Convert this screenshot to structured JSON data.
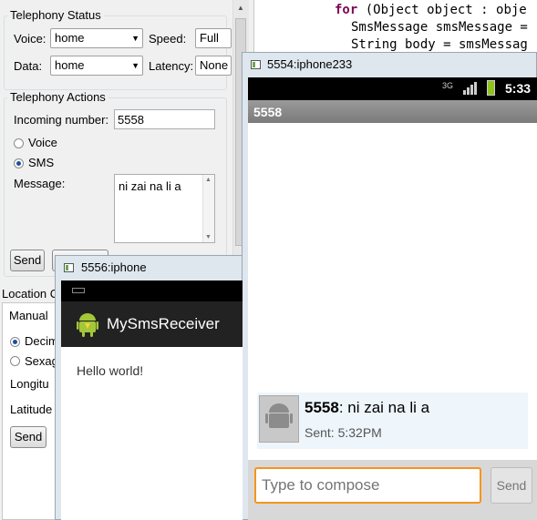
{
  "telephony_status": {
    "title": "Telephony Status",
    "voice_label": "Voice:",
    "voice_value": "home",
    "speed_label": "Speed:",
    "speed_value": "Full",
    "data_label": "Data:",
    "data_value": "home",
    "latency_label": "Latency:",
    "latency_value": "None"
  },
  "telephony_actions": {
    "title": "Telephony Actions",
    "incoming_label": "Incoming number:",
    "incoming_value": "5558",
    "voice_radio": "Voice",
    "sms_radio": "SMS",
    "message_label": "Message:",
    "message_value": "ni zai na li a",
    "send_label": "Send"
  },
  "location_controls": {
    "title": "Location C",
    "tab_manual": "Manual",
    "decimal_radio": "Decim",
    "sexagesimal_radio": "Sexag",
    "longitude_label": "Longitu",
    "latitude_label": "Latitude",
    "send_label": "Send"
  },
  "code_editor": {
    "lines": [
      {
        "kw": "for",
        "rest": " (Object object : obje"
      },
      {
        "kw": "",
        "rest": "SmsMessage smsMessage ="
      },
      {
        "kw": "",
        "rest": "String body = smsMessag"
      }
    ]
  },
  "emulator_5554": {
    "window_title": "5554:iphone233",
    "status_network": "3G",
    "status_time": "5:33",
    "conversation_title": "5558",
    "message_sender": "5558",
    "message_text": ": ni zai na li a",
    "message_sent": "Sent: 5:32PM",
    "compose_placeholder": "Type to compose",
    "send_label": "Send"
  },
  "emulator_5556": {
    "window_title": "5556:iphone",
    "app_title": "MySmsReceiver",
    "body_text": "Hello world!"
  },
  "colors": {
    "android_black": "#000000",
    "action_bar": "#222222",
    "compose_border": "#f7941d",
    "title_bar_grey": "#8a8a8a",
    "battery_green": "#8fc31f"
  }
}
